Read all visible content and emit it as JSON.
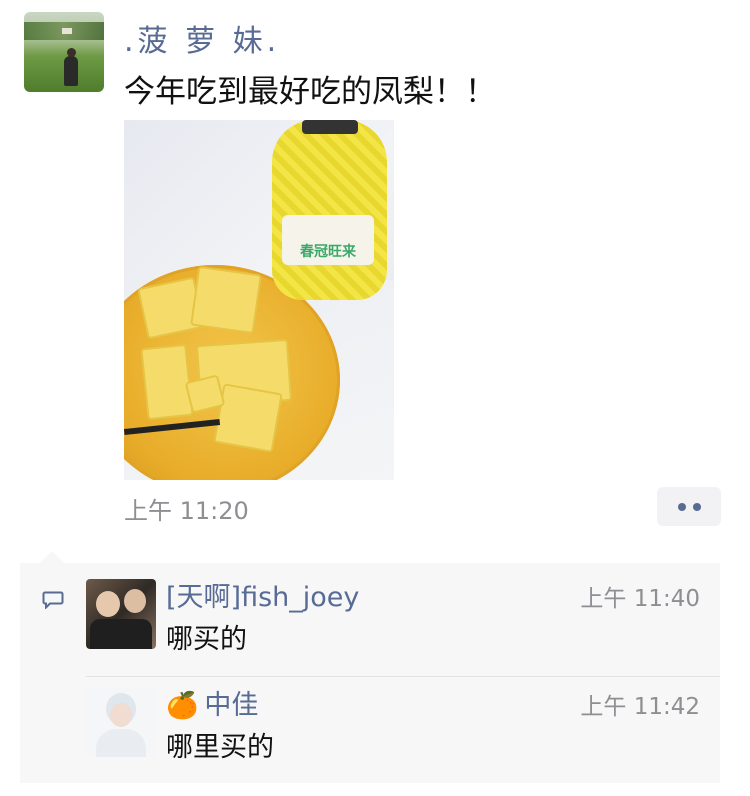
{
  "post": {
    "username": ".菠 萝 妹.",
    "text": "今年吃到最好吃的凤梨！！",
    "time": "上午 11:20",
    "photo": {
      "bottle_label": "春冠旺来"
    }
  },
  "comments": [
    {
      "name": "[天啊]fish_joey",
      "time": "上午 11:40",
      "text": "哪买的"
    },
    {
      "emoji": "🍊",
      "name": "中佳",
      "time": "上午 11:42",
      "text": "哪里买的"
    }
  ],
  "colors": {
    "link": "#576b95",
    "time": "#8e8e93",
    "comment_bg": "#f7f7f7"
  },
  "icons": {
    "more": "more-dots-icon",
    "comment": "comment-bubble-icon"
  }
}
